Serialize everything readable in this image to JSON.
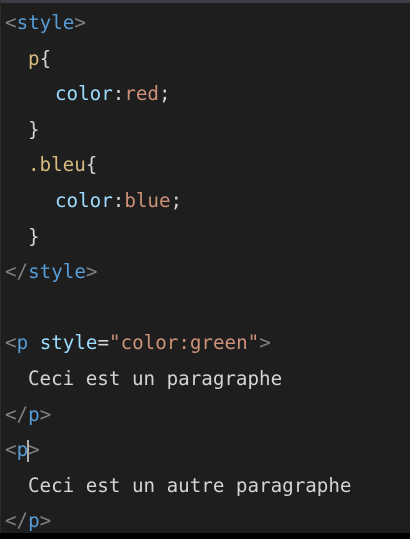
{
  "colors": {
    "background": "#1e1e1e",
    "tag_bracket": "#808080",
    "tag_name": "#569cd6",
    "selector": "#d7ba7d",
    "property": "#9cdcfe",
    "value": "#ce9178",
    "attribute": "#9cdcfe",
    "string": "#ce9178",
    "text": "#d4d4d4"
  },
  "code": {
    "l1": {
      "open": "<",
      "tag": "style",
      "close": ">"
    },
    "l2": {
      "selector": "p",
      "brace": "{"
    },
    "l3": {
      "prop": "color",
      "colon": ":",
      "value": "red",
      "semi": ";"
    },
    "l4": {
      "brace": "}"
    },
    "l5": {
      "selector": ".bleu",
      "brace": "{"
    },
    "l6": {
      "prop": "color",
      "colon": ":",
      "value": "blue",
      "semi": ";"
    },
    "l7": {
      "brace": "}"
    },
    "l8": {
      "open": "</",
      "tag": "style",
      "close": ">"
    },
    "l10": {
      "open": "<",
      "tag": "p",
      "space": " ",
      "attr": "style",
      "eq": "=",
      "string": "\"color:green\"",
      "close": ">"
    },
    "l11": {
      "text": "Ceci est un paragraphe"
    },
    "l12": {
      "open": "</",
      "tag": "p",
      "close": ">"
    },
    "l13": {
      "open": "<",
      "tag_before_cursor": "p",
      "close": ">"
    },
    "l14": {
      "text": "Ceci est un autre paragraphe"
    },
    "l15": {
      "open": "</",
      "tag": "p",
      "close": ">"
    }
  }
}
